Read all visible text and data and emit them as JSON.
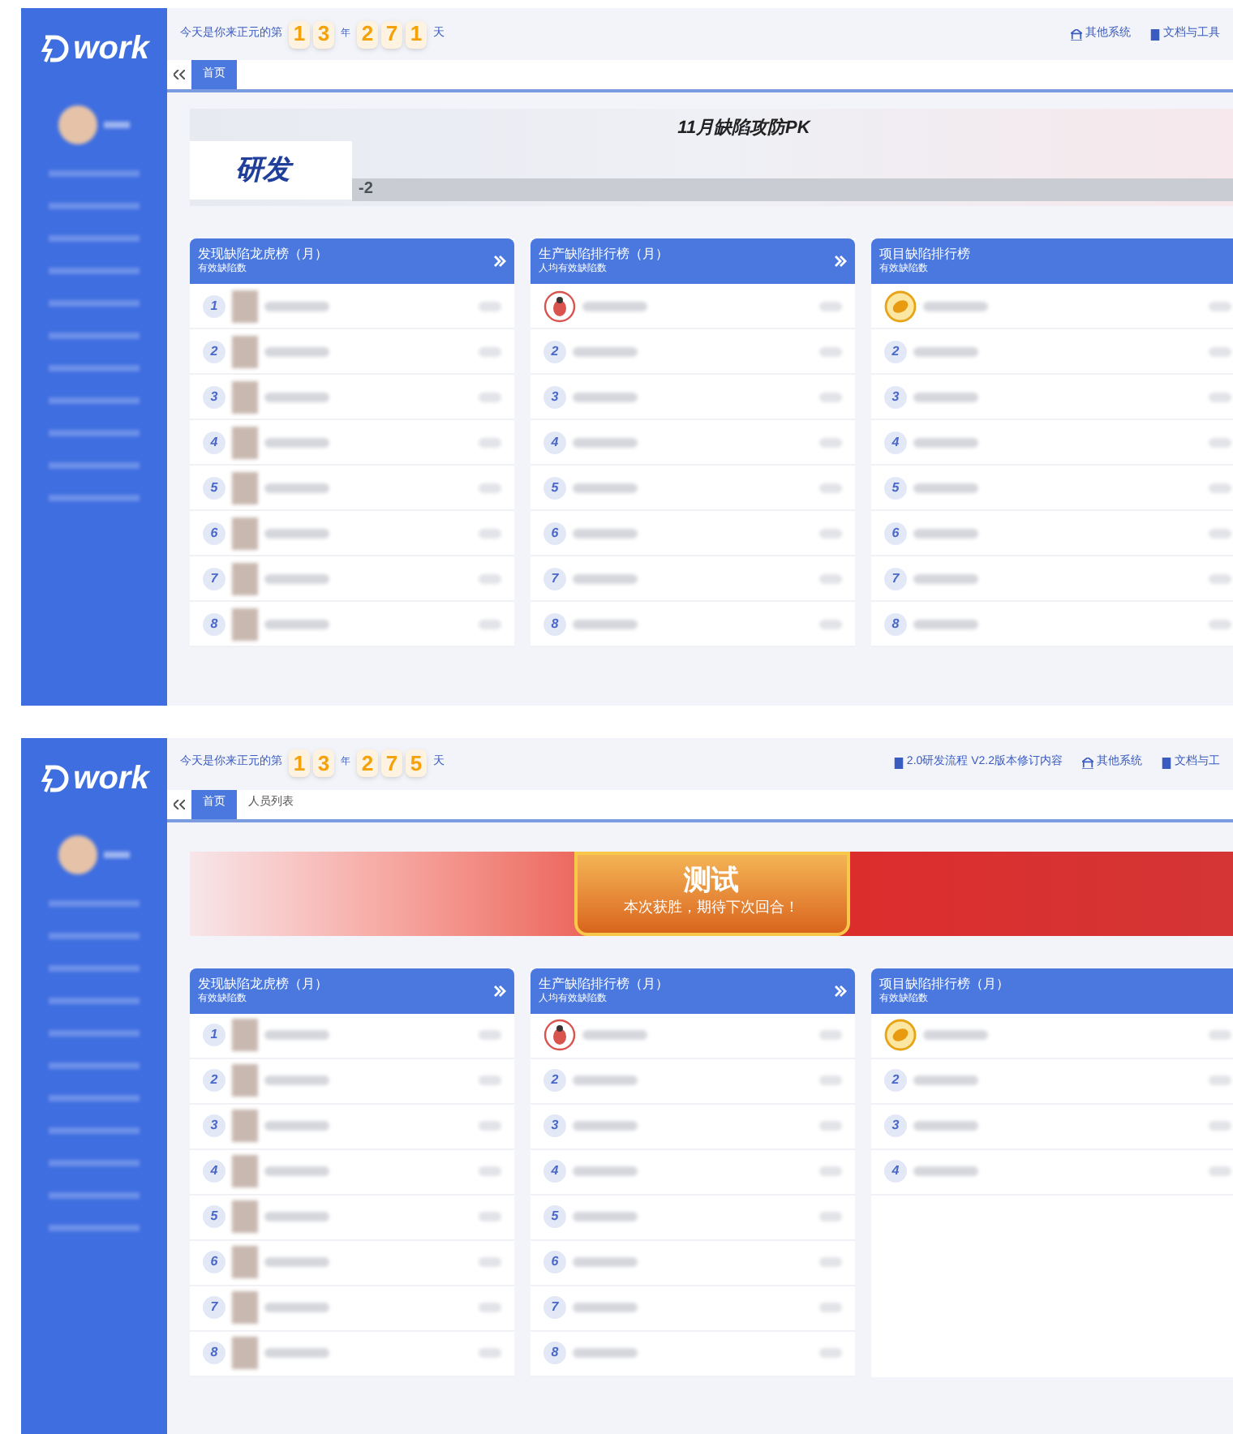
{
  "screens": [
    {
      "logo": "work",
      "counter": {
        "prefix": "今天是你来正元的第",
        "year_digits": [
          "1",
          "3"
        ],
        "year_unit": "年",
        "day_digits": [
          "2",
          "7",
          "1"
        ],
        "day_unit": "天"
      },
      "links": [
        {
          "kind": "system",
          "label": "其他系统"
        },
        {
          "kind": "doc",
          "label": "文档与工具"
        }
      ],
      "tabs": [
        {
          "label": "首页",
          "selected": true
        }
      ],
      "banner": {
        "kind": "pk",
        "title": "11月缺陷攻防PK",
        "team": "研发",
        "score": "-2"
      },
      "boards": [
        {
          "title": "发现缺陷龙虎榜（月）",
          "subtitle": "有效缺陷数",
          "more": true,
          "avatars": true,
          "rows": [
            {
              "kind": "number",
              "rank": "1"
            },
            {
              "kind": "number",
              "rank": "2"
            },
            {
              "kind": "number",
              "rank": "3"
            },
            {
              "kind": "number",
              "rank": "4"
            },
            {
              "kind": "number",
              "rank": "5"
            },
            {
              "kind": "number",
              "rank": "6"
            },
            {
              "kind": "number",
              "rank": "7"
            },
            {
              "kind": "number",
              "rank": "8"
            }
          ]
        },
        {
          "title": "生产缺陷排行榜（月）",
          "subtitle": "人均有效缺陷数",
          "more": true,
          "avatars": false,
          "rows": [
            {
              "kind": "bug"
            },
            {
              "kind": "number",
              "rank": "2"
            },
            {
              "kind": "number",
              "rank": "3"
            },
            {
              "kind": "number",
              "rank": "4"
            },
            {
              "kind": "number",
              "rank": "5"
            },
            {
              "kind": "number",
              "rank": "6"
            },
            {
              "kind": "number",
              "rank": "7"
            },
            {
              "kind": "number",
              "rank": "8"
            }
          ]
        },
        {
          "title": "项目缺陷排行榜",
          "subtitle": "有效缺陷数",
          "more": false,
          "avatars": false,
          "rows": [
            {
              "kind": "medal"
            },
            {
              "kind": "number",
              "rank": "2"
            },
            {
              "kind": "number",
              "rank": "3"
            },
            {
              "kind": "number",
              "rank": "4"
            },
            {
              "kind": "number",
              "rank": "5"
            },
            {
              "kind": "number",
              "rank": "6"
            },
            {
              "kind": "number",
              "rank": "7"
            },
            {
              "kind": "number",
              "rank": "8"
            }
          ]
        }
      ]
    },
    {
      "logo": "work",
      "counter": {
        "prefix": "今天是你来正元的第",
        "year_digits": [
          "1",
          "3"
        ],
        "year_unit": "年",
        "day_digits": [
          "2",
          "7",
          "5"
        ],
        "day_unit": "天"
      },
      "links": [
        {
          "kind": "doc",
          "label": "2.0研发流程 V2.2版本修订内容"
        },
        {
          "kind": "system",
          "label": "其他系统"
        },
        {
          "kind": "doc",
          "label": "文档与工"
        }
      ],
      "tabs": [
        {
          "label": "首页",
          "selected": true
        },
        {
          "label": "人员列表",
          "selected": false
        }
      ],
      "banner": {
        "kind": "winner",
        "title": "测试",
        "message": "本次获胜，期待下次回合！"
      },
      "boards": [
        {
          "title": "发现缺陷龙虎榜（月）",
          "subtitle": "有效缺陷数",
          "more": true,
          "avatars": true,
          "rows": [
            {
              "kind": "number",
              "rank": "1"
            },
            {
              "kind": "number",
              "rank": "2"
            },
            {
              "kind": "number",
              "rank": "3"
            },
            {
              "kind": "number",
              "rank": "4"
            },
            {
              "kind": "number",
              "rank": "5"
            },
            {
              "kind": "number",
              "rank": "6"
            },
            {
              "kind": "number",
              "rank": "7"
            },
            {
              "kind": "number",
              "rank": "8"
            }
          ]
        },
        {
          "title": "生产缺陷排行榜（月）",
          "subtitle": "人均有效缺陷数",
          "more": true,
          "avatars": false,
          "rows": [
            {
              "kind": "bug"
            },
            {
              "kind": "number",
              "rank": "2"
            },
            {
              "kind": "number",
              "rank": "3"
            },
            {
              "kind": "number",
              "rank": "4"
            },
            {
              "kind": "number",
              "rank": "5"
            },
            {
              "kind": "number",
              "rank": "6"
            },
            {
              "kind": "number",
              "rank": "7"
            },
            {
              "kind": "number",
              "rank": "8"
            }
          ]
        },
        {
          "title": "项目缺陷排行榜（月）",
          "subtitle": "有效缺陷数",
          "more": false,
          "avatars": false,
          "rows": [
            {
              "kind": "medal"
            },
            {
              "kind": "number",
              "rank": "2"
            },
            {
              "kind": "number",
              "rank": "3"
            },
            {
              "kind": "number",
              "rank": "4"
            }
          ]
        }
      ]
    }
  ]
}
